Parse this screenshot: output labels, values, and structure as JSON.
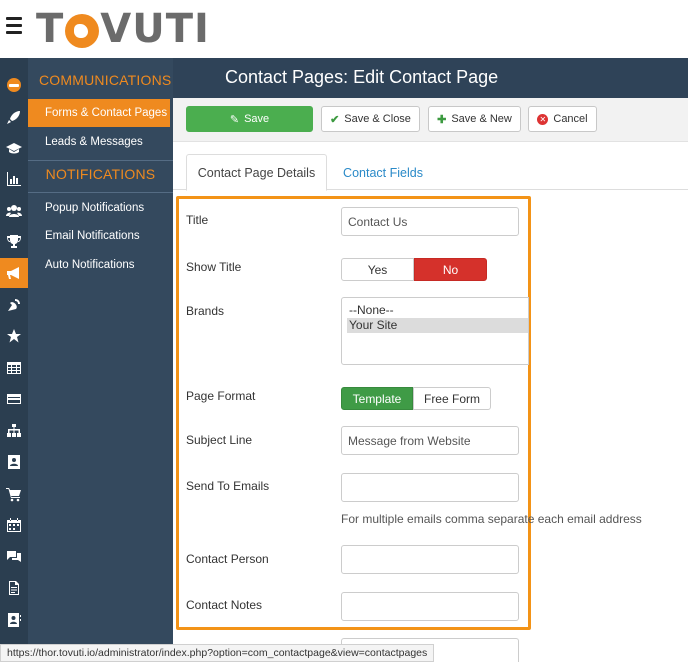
{
  "brand": {
    "logo_text_left": "T",
    "logo_text_right": "VUTI",
    "accent_color": "#ef8a1f"
  },
  "rail_icons": [
    "user-avatar-icon",
    "rocket-icon",
    "graduation-cap-icon",
    "bar-chart-icon",
    "users-icon",
    "trophy-icon",
    "megaphone-icon",
    "satellite-dish-icon",
    "star-icon",
    "table-icon",
    "credit-card-icon",
    "sitemap-icon",
    "contact-card-icon",
    "shopping-cart-icon",
    "calendar-icon",
    "chat-bubbles-icon",
    "document-icon",
    "address-book-icon"
  ],
  "nav": {
    "communications_heading": "COMMUNICATIONS",
    "forms_contact_pages": "Forms & Contact Pages",
    "leads_messages": "Leads & Messages",
    "notifications_heading": "NOTIFICATIONS",
    "popup_notifications": "Popup Notifications",
    "email_notifications": "Email Notifications",
    "auto_notifications": "Auto Notifications"
  },
  "header": {
    "title": "Contact Pages: Edit Contact Page"
  },
  "toolbar": {
    "save": "Save",
    "save_close": "Save & Close",
    "save_new": "Save & New",
    "cancel": "Cancel"
  },
  "tabs": {
    "details": "Contact Page Details",
    "fields": "Contact Fields"
  },
  "form": {
    "title_label": "Title",
    "title_value": "Contact Us",
    "show_title_label": "Show Title",
    "show_title_yes": "Yes",
    "show_title_no": "No",
    "show_title_selected": "No",
    "brands_label": "Brands",
    "brands_options": [
      "--None--",
      "Your Site"
    ],
    "brands_selected": "Your Site",
    "page_format_label": "Page Format",
    "page_format_template": "Template",
    "page_format_free": "Free Form",
    "page_format_selected": "Template",
    "subject_label": "Subject Line",
    "subject_value": "Message from Website",
    "send_to_label": "Send To Emails",
    "send_to_value": "",
    "send_to_hint": "For multiple emails comma separate each email address",
    "contact_person_label": "Contact Person",
    "contact_person_value": "",
    "contact_notes_label": "Contact Notes",
    "contact_notes_value": ""
  },
  "status_bar": {
    "url": "https://thor.tovuti.io/administrator/index.php?option=com_contactpage&view=contactpages"
  }
}
